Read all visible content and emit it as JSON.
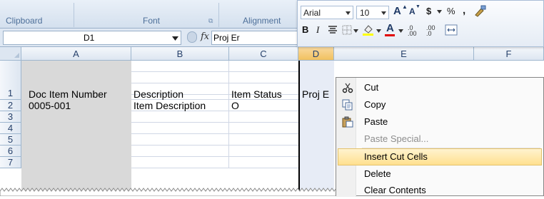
{
  "ribbon": {
    "groups": [
      {
        "label": "Clipboard",
        "launcher": "⧉"
      },
      {
        "label": "Font",
        "launcher": "⧉"
      },
      {
        "label": "Alignment",
        "launcher": ""
      }
    ]
  },
  "formula_bar": {
    "name_box": "D1",
    "fx_symbol": "fx",
    "value": "Proj Er"
  },
  "columns": [
    "A",
    "B",
    "C",
    "D",
    "E",
    "F"
  ],
  "rows": [
    "1",
    "2",
    "3",
    "4",
    "5",
    "6",
    "7"
  ],
  "cells": {
    "A1": "Doc Item Number",
    "B1": "Description",
    "C1": "Item Status",
    "D1": "Proj E",
    "A2": "0005-001",
    "B2": "Item Description",
    "C2": "O"
  },
  "mini_toolbar": {
    "font": "Arial",
    "size": "10",
    "grow_font": "A",
    "shrink_font": "A",
    "currency": "$",
    "percent": "%",
    "comma": ",",
    "bold": "B",
    "italic": "I",
    "font_color_letter": "A",
    "inc_decimal": ".0 .00",
    "dec_decimal": ".00 .0"
  },
  "context_menu": {
    "items": [
      {
        "label": "Cut",
        "icon": "scissors-icon",
        "disabled": false,
        "highlighted": false
      },
      {
        "label": "Copy",
        "icon": "copy-icon",
        "disabled": false,
        "highlighted": false
      },
      {
        "label": "Paste",
        "icon": "paste-icon",
        "disabled": false,
        "highlighted": false
      },
      {
        "label": "Paste Special...",
        "icon": "",
        "disabled": true,
        "highlighted": false
      },
      {
        "label": "Insert Cut Cells",
        "icon": "",
        "disabled": false,
        "highlighted": true
      },
      {
        "label": "Delete",
        "icon": "",
        "disabled": false,
        "highlighted": false
      },
      {
        "label": "Clear Contents",
        "icon": "",
        "disabled": false,
        "highlighted": false
      }
    ]
  },
  "colors": {
    "highlight": "#ffe08f",
    "column_a_fill": "#d9d9d9",
    "header_blue": "#27416b"
  }
}
